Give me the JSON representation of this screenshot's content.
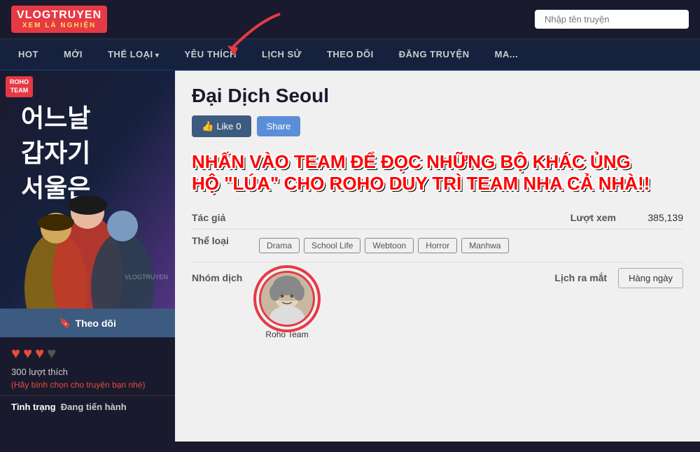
{
  "header": {
    "logo_top": "VLOGTRUYEN",
    "logo_bottom": "XEM LÀ NGHIỆN",
    "search_placeholder": "Nhập tên truyện"
  },
  "nav": {
    "items": [
      {
        "label": "HOT",
        "has_arrow": false
      },
      {
        "label": "MỚI",
        "has_arrow": false
      },
      {
        "label": "THỂ LOẠI",
        "has_arrow": true
      },
      {
        "label": "YÊU THÍCH",
        "has_arrow": false
      },
      {
        "label": "LỊCH SỬ",
        "has_arrow": false
      },
      {
        "label": "THEO DÕI",
        "has_arrow": false
      },
      {
        "label": "ĐĂNG TRUYỆN",
        "has_arrow": false
      },
      {
        "label": "MA...",
        "has_arrow": false
      }
    ]
  },
  "manga": {
    "title": "Đại Dịch Seoul",
    "cover_title": "어느날 갑자기 서울은",
    "cover_badge_line1": "ROHO",
    "cover_badge_line2": "TEAM",
    "watermark": "VLOGTRUYEN",
    "follow_label": "Theo dõi",
    "likes_count": "300 lượt thích",
    "likes_prompt": "(Hãy bình chọn cho truyện bạn nhé)",
    "status_label": "Tình trạng",
    "status_value": "Đang tiến hành",
    "like_btn": "Like",
    "like_count": "0",
    "share_btn": "Share",
    "promo_text_line1": "NHẤN VÀO TEAM ĐỂ ĐỌC NHỮNG BỘ KHÁC ỦNG",
    "promo_text_line2": "HỘ \"LÚA\" CHO ROHO DUY TRÌ TEAM NHA CẢ NHÀ!!",
    "author_label": "Tác giả",
    "author_value": "",
    "views_label": "Lượt xem",
    "views_value": "385,139",
    "genre_label": "Thể loại",
    "genres": [
      "Drama",
      "School Life",
      "Webtoon",
      "Horror",
      "Manhwa"
    ],
    "group_label": "Nhóm dịch",
    "group_name": "Roho Team",
    "release_label": "Lịch ra mắt",
    "release_value": "Hàng ngày"
  }
}
